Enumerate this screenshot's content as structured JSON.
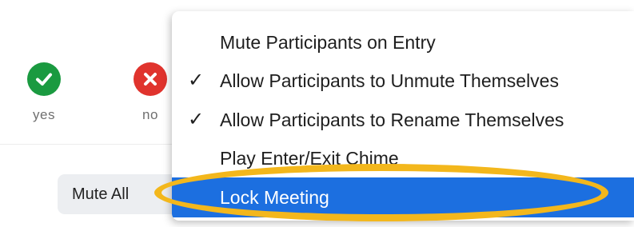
{
  "feedback": {
    "yes_label": "yes",
    "no_label": "no",
    "yes_icon": "check-circle-icon",
    "no_icon": "x-circle-icon",
    "yes_color": "#1a9a40",
    "no_color": "#e0332d"
  },
  "mute_all_label": "Mute All",
  "menu": {
    "items": [
      {
        "label": "Mute Participants on Entry",
        "checked": false
      },
      {
        "label": "Allow Participants to Unmute Themselves",
        "checked": true,
        "check": "✓"
      },
      {
        "label": "Allow Participants to Rename Themselves",
        "checked": true,
        "check": "✓"
      },
      {
        "label": "Play Enter/Exit Chime",
        "checked": false
      },
      {
        "label": "Lock Meeting",
        "checked": false,
        "selected": true
      }
    ],
    "selected_color": "#1c6fe0"
  },
  "annotation": {
    "highlight_color": "#f3b71c",
    "target": "Lock Meeting"
  }
}
